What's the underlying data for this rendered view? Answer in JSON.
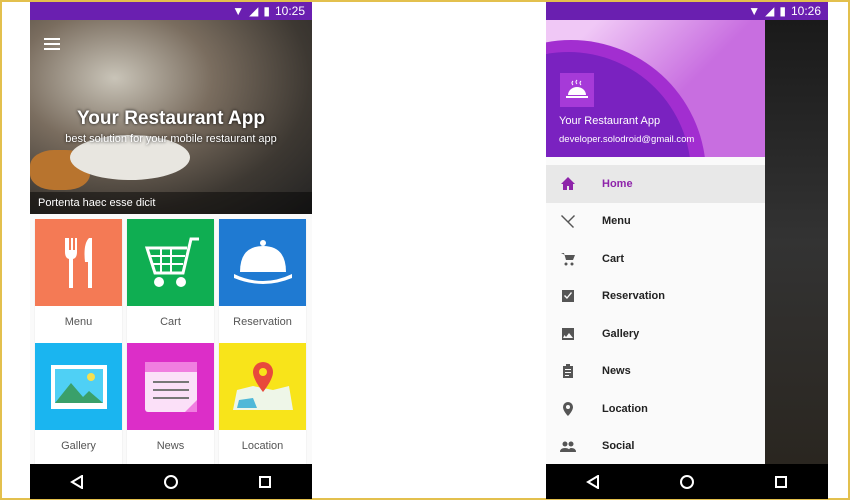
{
  "left": {
    "status_time": "10:25",
    "hero": {
      "title": "Your Restaurant App",
      "subtitle": "best solution for your mobile restaurant app",
      "caption": "Portenta haec esse dicit"
    },
    "tiles": [
      {
        "label": "Menu",
        "color": "#f47a55",
        "icon": "fork-knife-icon"
      },
      {
        "label": "Cart",
        "color": "#0fae52",
        "icon": "cart-icon"
      },
      {
        "label": "Reservation",
        "color": "#1f7ad2",
        "icon": "service-bell-icon"
      },
      {
        "label": "Gallery",
        "color": "#1ab5f0",
        "icon": "image-icon"
      },
      {
        "label": "News",
        "color": "#dc2ec8",
        "icon": "notepad-icon"
      },
      {
        "label": "Location",
        "color": "#f8e41a",
        "icon": "map-pin-icon"
      }
    ]
  },
  "right": {
    "status_time": "10:26",
    "drawer": {
      "app_name": "Your Restaurant App",
      "email": "developer.solodroid@gmail.com",
      "items": [
        {
          "label": "Home",
          "icon": "home-icon",
          "active": true
        },
        {
          "label": "Menu",
          "icon": "fork-knife-icon"
        },
        {
          "label": "Cart",
          "icon": "cart-icon"
        },
        {
          "label": "Reservation",
          "icon": "checkbox-icon"
        },
        {
          "label": "Gallery",
          "icon": "image-icon"
        },
        {
          "label": "News",
          "icon": "clipboard-icon"
        },
        {
          "label": "Location",
          "icon": "location-icon"
        },
        {
          "label": "Social",
          "icon": "people-icon"
        }
      ]
    }
  },
  "colors": {
    "status_bar": "#6a1fb0",
    "accent": "#8e24aa"
  }
}
